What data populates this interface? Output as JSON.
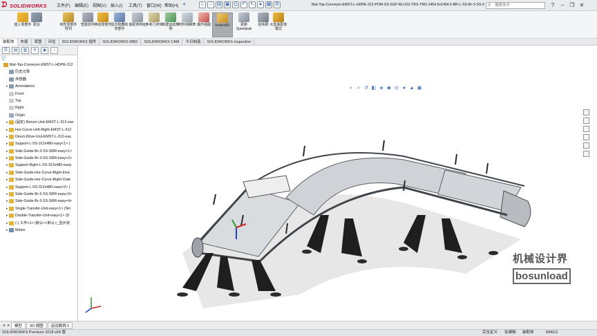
{
  "app": {
    "logo_text": "SOLIDWORKS",
    "menus": [
      "文件(F)",
      "编辑(E)",
      "视图(V)",
      "插入(I)",
      "工具(T)",
      "窗口(W)",
      "帮助(H)"
    ],
    "document_title": "Mat-Top-Conveyor-EMST-L-HDPE-312-POM-SS-SSP-RU-DU-TRS-TRD-1454.5x1454.5-BR-L-SS-Br-3-SS-5...",
    "search_placeholder": "搜索命令"
  },
  "commands": [
    {
      "label": "插入零部件"
    },
    {
      "label": "配合"
    },
    {
      "label": "线性零部件阵列"
    },
    {
      "label": "智能扣件"
    },
    {
      "label": "移动零部件"
    },
    {
      "label": "显示隐藏的零部件"
    },
    {
      "label": "装配体特征"
    },
    {
      "label": "参考几何体"
    },
    {
      "label": "新建运动算例"
    },
    {
      "label": "材料明细表"
    },
    {
      "label": "爆炸视图"
    },
    {
      "label": "Instant3D"
    },
    {
      "label": "更新Speedpak"
    },
    {
      "label": "拍快照"
    },
    {
      "label": "大型装配体模式"
    }
  ],
  "tabs": [
    "装配体",
    "布局",
    "草图",
    "评估",
    "SOLIDWORKS 插件",
    "SOLIDWORKS MBD",
    "SOLIDWORKS CAM",
    "今日制造",
    "SOLIDWORKS Inspection"
  ],
  "tree": [
    {
      "label": "Mat-Top-Conveyor-EMST-L-HDPE-312",
      "level": 0,
      "icon": "assembly",
      "expand": ""
    },
    {
      "label": "历史记录",
      "level": 1,
      "icon": "folder",
      "expand": ""
    },
    {
      "label": "传感器",
      "level": 1,
      "icon": "folder",
      "expand": ""
    },
    {
      "label": "Annotations",
      "level": 1,
      "icon": "folder",
      "expand": "▸"
    },
    {
      "label": "Front",
      "level": 1,
      "icon": "plane",
      "expand": ""
    },
    {
      "label": "Top",
      "level": 1,
      "icon": "plane",
      "expand": ""
    },
    {
      "label": "Right",
      "level": 1,
      "icon": "plane",
      "expand": ""
    },
    {
      "label": "Origin",
      "level": 1,
      "icon": "origin",
      "expand": ""
    },
    {
      "label": "(固定) Return-Unit-EMST-L-312-eas",
      "level": 1,
      "icon": "part",
      "expand": "▸"
    },
    {
      "label": "Hor-Curve-Unit-Right-EMST-L-312",
      "level": 1,
      "icon": "part",
      "expand": "▸"
    },
    {
      "label": "Direct-Drive-Unit-EMST-L-312-eas",
      "level": 1,
      "icon": "part",
      "expand": "▸"
    },
    {
      "label": "Support-L-SS-312x480-easy<1> (",
      "level": 1,
      "icon": "part",
      "expand": "▸"
    },
    {
      "label": "Side-Guide-Br-3-SS-SRR-easy<1>",
      "level": 1,
      "icon": "part",
      "expand": "▸"
    },
    {
      "label": "Side-Guide-Br-3-SS-SRR-easy<2>",
      "level": 1,
      "icon": "part",
      "expand": "▸"
    },
    {
      "label": "Support-Right-L-SS-312x480-easy",
      "level": 1,
      "icon": "part",
      "expand": "▸"
    },
    {
      "label": "Side-Guide-Hor-Curve-Right-Inne",
      "level": 1,
      "icon": "part",
      "expand": "▸"
    },
    {
      "label": "Side-Guide-Hor-Curve-Right-Oute",
      "level": 1,
      "icon": "part",
      "expand": "▸"
    },
    {
      "label": "Support-L-SS-312x480-easy<2> (",
      "level": 1,
      "icon": "part",
      "expand": "▸"
    },
    {
      "label": "Side-Guide-Br-3-SS-SRR-easy<3>",
      "level": 1,
      "icon": "part",
      "expand": "▸"
    },
    {
      "label": "Side-Guide-Br-3-SS-SRR-easy<4>",
      "level": 1,
      "icon": "part",
      "expand": "▸"
    },
    {
      "label": "Single-Transfer-Unit-easy<1> (Sin",
      "level": 1,
      "icon": "part",
      "expand": "▸"
    },
    {
      "label": "Double-Transfer-Unit-easy<1> (D",
      "level": 1,
      "icon": "part",
      "expand": "▸"
    },
    {
      "label": "(-) 工件<1> (默认<<默认>_显示状",
      "level": 1,
      "icon": "part",
      "expand": "▸"
    },
    {
      "label": "Mates",
      "level": 1,
      "icon": "mates",
      "expand": "▸"
    }
  ],
  "watermark": {
    "cn": "机械设计界",
    "en": "bosunload"
  },
  "model_tabs": [
    "模型",
    "3D 视图",
    "运动算例 1"
  ],
  "status": {
    "product": "SOLIDWORKS Premium 2018 x64 版",
    "items": [
      "完全定义",
      "在编辑",
      "装配体",
      "MMGS"
    ]
  },
  "colors": {
    "accent": "#c8102e",
    "toolbar_bg": "#f4f5f6",
    "axis_x": "#d42020",
    "axis_y": "#2a9d2a",
    "axis_z": "#2040c8"
  }
}
